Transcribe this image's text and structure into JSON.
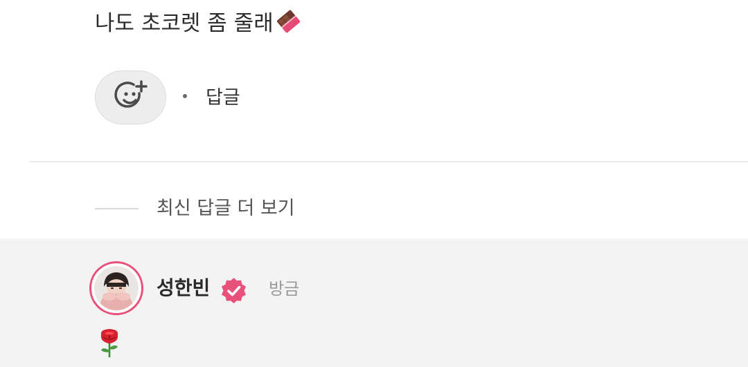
{
  "comment": {
    "text": "나도 초코렛 좀 줄래",
    "emoji": "chocolate-bar"
  },
  "actions": {
    "reaction_icon": "add-emoji-icon",
    "reply_label": "답글"
  },
  "more_replies": {
    "label": "최신 답글 더 보기"
  },
  "reply": {
    "author": "성한빈",
    "verified_icon": "verified-badge-icon",
    "time": "방금",
    "content_emoji": "rose",
    "accent_color": "#e8527a"
  }
}
